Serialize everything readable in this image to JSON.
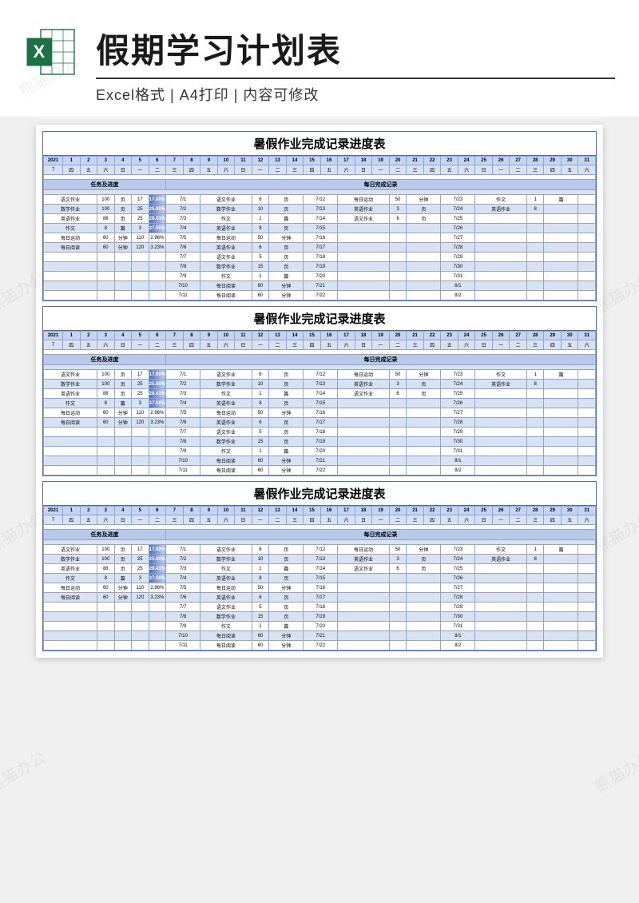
{
  "header": {
    "title": "假期学习计划表",
    "subtitle": "Excel格式 | A4打印 | 内容可修改"
  },
  "sheet": {
    "title": "暑假作业完成记录进度表",
    "year": "2021",
    "month": "7",
    "days": [
      "1",
      "2",
      "3",
      "4",
      "5",
      "6",
      "7",
      "8",
      "9",
      "10",
      "11",
      "12",
      "13",
      "14",
      "15",
      "16",
      "17",
      "18",
      "19",
      "20",
      "21",
      "22",
      "23",
      "24",
      "25",
      "26",
      "27",
      "28",
      "29",
      "30",
      "31"
    ],
    "weekdays": [
      "四",
      "五",
      "六",
      "日",
      "一",
      "二",
      "三",
      "四",
      "五",
      "六",
      "日",
      "一",
      "二",
      "三",
      "四",
      "五",
      "六",
      "日",
      "一",
      "二",
      "三",
      "四",
      "五",
      "六",
      "日",
      "一",
      "二",
      "三",
      "四",
      "五",
      "六"
    ],
    "section1": "任务及进度",
    "section2": "每日完成记录",
    "tasks": [
      {
        "name": "语文作业",
        "total": "100",
        "unit": "页",
        "done": "17",
        "pct": "17.00%"
      },
      {
        "name": "数学作业",
        "total": "100",
        "unit": "页",
        "done": "25",
        "pct": "25.00%"
      },
      {
        "name": "英语作业",
        "total": "88",
        "unit": "页",
        "done": "25",
        "pct": "28.41%"
      },
      {
        "name": "作文",
        "total": "8",
        "unit": "篇",
        "done": "3",
        "pct": "37.50%"
      },
      {
        "name": "每日运动",
        "total": "60",
        "unit": "分钟",
        "done": "110",
        "pct": "2.96%"
      },
      {
        "name": "每日阅读",
        "total": "60",
        "unit": "分钟",
        "done": "120",
        "pct": "3.23%"
      }
    ],
    "log1": [
      {
        "d": "7/1",
        "t": "语文作业",
        "v": "6",
        "u": "页"
      },
      {
        "d": "7/2",
        "t": "数学作业",
        "v": "10",
        "u": "页"
      },
      {
        "d": "7/3",
        "t": "作文",
        "v": "1",
        "u": "篇"
      },
      {
        "d": "7/4",
        "t": "英语作业",
        "v": "8",
        "u": "页"
      },
      {
        "d": "7/5",
        "t": "每日运动",
        "v": "50",
        "u": "分钟"
      },
      {
        "d": "7/6",
        "t": "英语作业",
        "v": "6",
        "u": "页"
      },
      {
        "d": "7/7",
        "t": "语文作业",
        "v": "5",
        "u": "页"
      },
      {
        "d": "7/8",
        "t": "数学作业",
        "v": "15",
        "u": "页"
      },
      {
        "d": "7/9",
        "t": "作文",
        "v": "1",
        "u": "篇"
      },
      {
        "d": "7/10",
        "t": "每日阅读",
        "v": "60",
        "u": "分钟"
      },
      {
        "d": "7/11",
        "t": "每日阅读",
        "v": "60",
        "u": "分钟"
      }
    ],
    "log2": [
      {
        "d": "7/12",
        "t": "每日运动",
        "v": "50",
        "u": "分钟"
      },
      {
        "d": "7/13",
        "t": "英语作业",
        "v": "3",
        "u": "页"
      },
      {
        "d": "7/14",
        "t": "语文作业",
        "v": "6",
        "u": "页"
      },
      {
        "d": "7/15",
        "t": "",
        "v": "",
        "u": ""
      },
      {
        "d": "7/16",
        "t": "",
        "v": "",
        "u": ""
      },
      {
        "d": "7/17",
        "t": "",
        "v": "",
        "u": ""
      },
      {
        "d": "7/18",
        "t": "",
        "v": "",
        "u": ""
      },
      {
        "d": "7/19",
        "t": "",
        "v": "",
        "u": ""
      },
      {
        "d": "7/20",
        "t": "",
        "v": "",
        "u": ""
      },
      {
        "d": "7/21",
        "t": "",
        "v": "",
        "u": ""
      },
      {
        "d": "7/22",
        "t": "",
        "v": "",
        "u": ""
      }
    ],
    "log3": [
      {
        "d": "7/23",
        "t": "作文",
        "v": "1",
        "u": "篇"
      },
      {
        "d": "7/24",
        "t": "英语作业",
        "v": "8",
        "u": ""
      },
      {
        "d": "7/25",
        "t": "",
        "v": "",
        "u": ""
      },
      {
        "d": "7/26",
        "t": "",
        "v": "",
        "u": ""
      },
      {
        "d": "7/27",
        "t": "",
        "v": "",
        "u": ""
      },
      {
        "d": "7/28",
        "t": "",
        "v": "",
        "u": ""
      },
      {
        "d": "7/29",
        "t": "",
        "v": "",
        "u": ""
      },
      {
        "d": "7/30",
        "t": "",
        "v": "",
        "u": ""
      },
      {
        "d": "7/31",
        "t": "",
        "v": "",
        "u": ""
      },
      {
        "d": "8/1",
        "t": "",
        "v": "",
        "u": ""
      },
      {
        "d": "8/2",
        "t": "",
        "v": "",
        "u": ""
      }
    ]
  },
  "watermark": "熊猫办公"
}
